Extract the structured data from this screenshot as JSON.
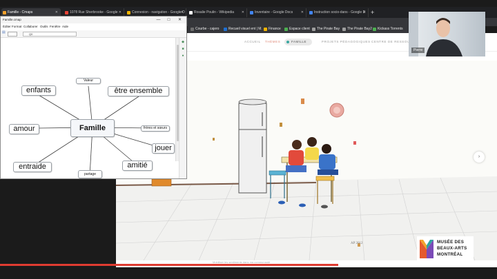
{
  "browser": {
    "tabs": [
      {
        "label": "Famille - Cmaps",
        "color": "#f4a12a",
        "active": true
      },
      {
        "label": "1078 Rue Sherbrooke - Google",
        "color": "#e84335"
      },
      {
        "label": "Connexion - navigation - Google D",
        "color": "#f4b400"
      },
      {
        "label": "Rosalie Poulin - Wikipedia",
        "color": "#ffffff"
      },
      {
        "label": "Inventaire - Google Docs",
        "color": "#4285f4"
      },
      {
        "label": "Instruction socio-dans - Google D",
        "color": "#4285f4"
      }
    ],
    "new_tab": "+",
    "bookmarks": [
      {
        "label": "Courbe - cajero",
        "color": "#6d6d6d"
      },
      {
        "label": "Recueil visuel ent | M.",
        "color": "#1f6fd1"
      },
      {
        "label": "Finance",
        "color": "#f4b400"
      },
      {
        "label": "Espace client",
        "color": "#4caf50"
      },
      {
        "label": "The Pirate Bay",
        "color": "#9e9e9e"
      },
      {
        "label": "The Pirate Bay2",
        "color": "#9e9e9e"
      },
      {
        "label": "Kickass Torrents",
        "color": "#4caf50"
      }
    ]
  },
  "site": {
    "nav": {
      "item1": "ACCUEIL",
      "item2": "THÈMES",
      "pill": "FAMILLE",
      "item3": "PROJETS PÉDAGOGIQUES",
      "item4": "CENTRE DE RESSOURCES"
    },
    "caption": "Mobiliser les sentiments dans ma communauté",
    "signature": "AP 2012",
    "next_arrow": "›",
    "progress": 0.68,
    "logo": {
      "line1": "MUSÉE DES",
      "line2": "BEAUX-ARTS",
      "line3": "MONTRÉAL"
    }
  },
  "mindmap_window": {
    "title": "Famille.cmap",
    "minimize": "—",
    "maximize": "□",
    "close": "✕",
    "menu": [
      "Éditer",
      "Format",
      "Collaborer",
      "Outils",
      "Fenêtre",
      "Aide"
    ],
    "search_value": "Q0",
    "center_node": "Famille",
    "nodes": {
      "enfants": "enfants",
      "valeur": "Valeur",
      "etre_ensemble": "être ensemble",
      "amour": "amour",
      "freres": "frères et sœurs",
      "jouer": "jouer",
      "entraide": "entraide",
      "partage": "partage",
      "amitie": "amitié"
    }
  },
  "webcam": {
    "name": "Pierre"
  }
}
